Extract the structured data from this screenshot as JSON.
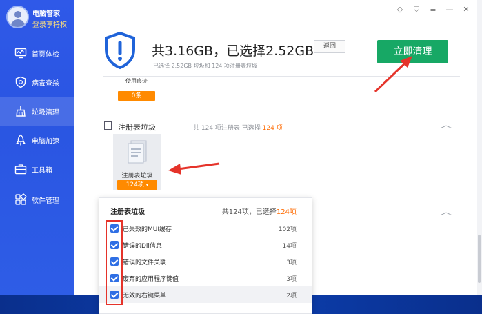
{
  "app": {
    "brand": "电脑管家",
    "login_link": "登录享特权",
    "colors": {
      "sidebar": "#2f59e8",
      "accent_green": "#17a865",
      "accent_orange": "#ff8a00",
      "checkbox_blue": "#2f6fe4",
      "highlight_red": "#e5332a"
    }
  },
  "sidebar": {
    "items": [
      {
        "label": "首页体检",
        "icon": "monitor-icon"
      },
      {
        "label": "病毒查杀",
        "icon": "shield-bug-icon"
      },
      {
        "label": "垃圾清理",
        "icon": "broom-icon",
        "active": true
      },
      {
        "label": "电脑加速",
        "icon": "rocket-icon"
      },
      {
        "label": "工具箱",
        "icon": "toolbox-icon"
      },
      {
        "label": "软件管理",
        "icon": "apps-icon"
      }
    ]
  },
  "window_icons": [
    "skin-icon",
    "shirt-icon",
    "menu-icon",
    "minimize-icon",
    "close-icon"
  ],
  "summary": {
    "headline": "共3.16GB，已选择2.52GB",
    "back_label": "返回",
    "detail": "已选择 2.52GB 垃圾和 124 项注册表垃圾",
    "clean_button": "立即清理"
  },
  "partial_card": {
    "label": "使用痕迹",
    "count": "0条"
  },
  "registry_section": {
    "title": "注册表垃圾",
    "stats_prefix": "共 124 项注册表 已选择",
    "stats_selected": "124 项",
    "card_label": "注册表垃圾",
    "card_count": "124项"
  },
  "popup": {
    "title": "注册表垃圾",
    "summary_prefix": "共124项，已选择",
    "summary_selected": "124项",
    "rows": [
      {
        "name": "已失效的MUI缓存",
        "qty": "102项",
        "checked": true
      },
      {
        "name": "错误的Dll信息",
        "qty": "14项",
        "checked": true
      },
      {
        "name": "错误的文件关联",
        "qty": "3项",
        "checked": true
      },
      {
        "name": "废弃的应用程序键值",
        "qty": "3项",
        "checked": true
      },
      {
        "name": "无效的右键菜单",
        "qty": "2项",
        "checked": true
      }
    ]
  }
}
